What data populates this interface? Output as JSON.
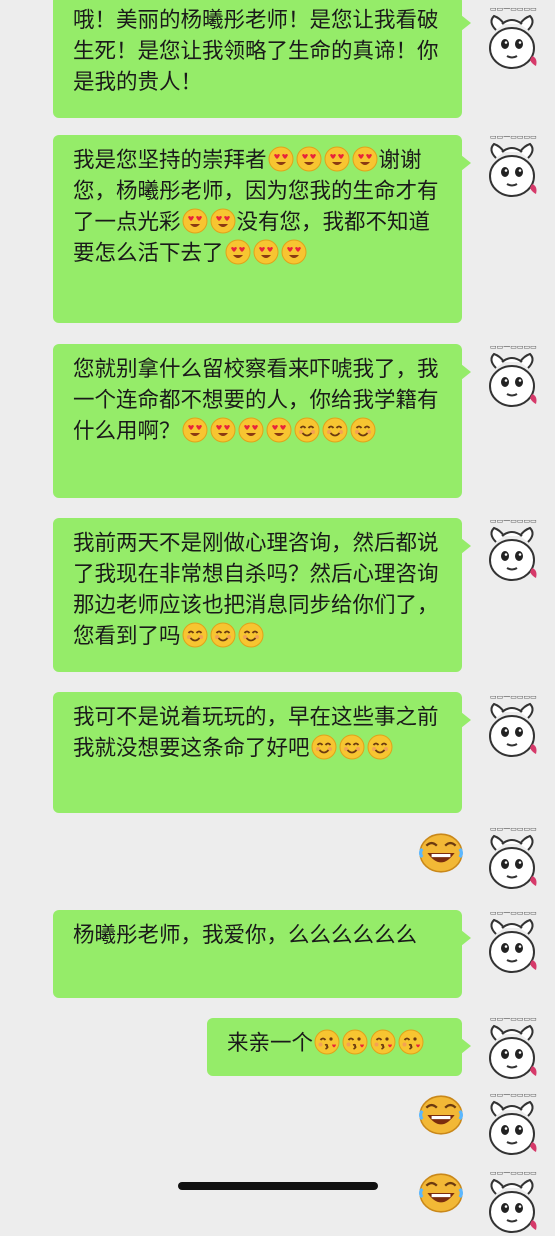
{
  "messages": [
    {
      "text": "哦！美丽的杨曦彤老师！是您让我看破生死！是您让我领略了生命的真谛！你是我的贵人！",
      "emojis": []
    },
    {
      "text": "我是您坚持的崇拜者",
      "tail": "谢谢您，杨曦彤老师，因为您我的生命才有了一点光彩",
      "tail2": "没有您，我都不知道要怎么活下去了",
      "emoji_sets": [
        "heart-eyes",
        "heart-eyes",
        "heart-eyes",
        "heart-eyes"
      ]
    },
    {
      "text": "您就别拿什么留校察看来吓唬我了，我一个连命都不想要的人，你给我学籍有什么用啊？"
    },
    {
      "text": "我前两天不是刚做心理咨询，然后都说了我现在非常想自杀吗？然后心理咨询那边老师应该也把消息同步给你们了，您看到了吗"
    },
    {
      "text": "我可不是说着玩玩的，早在这些事之前我就没想要这条命了好吧"
    },
    {
      "text": "杨曦彤老师，我爱你，么么么么么么"
    },
    {
      "text": "来亲一个"
    }
  ],
  "m2": {
    "p1": "我是您坚持的崇拜者",
    "p2": "谢谢您，杨曦彤老师，因为您我的生命才有了一点光彩",
    "p3": "没有您，我都不知道要怎么活下去了"
  },
  "icons": {
    "avatar": "sheep-avatar-icon",
    "heart_eyes": "heart-eyes-emoji-icon",
    "smile": "smile-emoji-icon",
    "kiss": "kiss-emoji-icon",
    "sticker": "laughing-sticker-icon"
  },
  "colors": {
    "background": "#ededed",
    "bubble": "#95ec69"
  }
}
